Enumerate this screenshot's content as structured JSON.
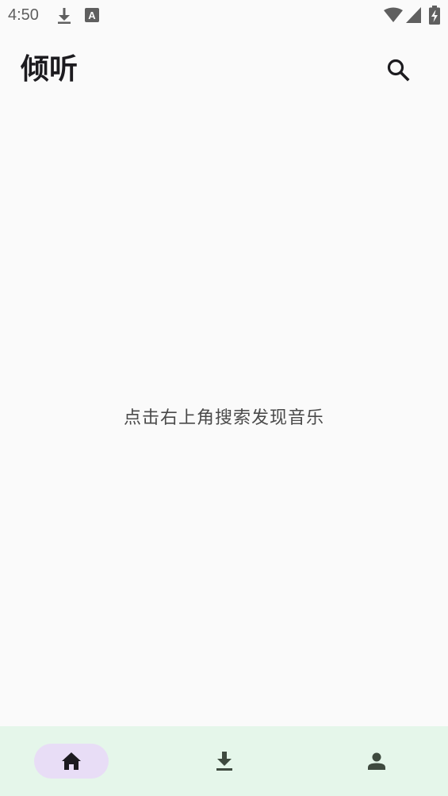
{
  "status_bar": {
    "time": "4:50",
    "icons": [
      "download-icon",
      "keyboard-a-icon",
      "wifi-icon",
      "signal-icon",
      "battery-charging-icon"
    ]
  },
  "app_bar": {
    "title": "倾听",
    "search_icon": "search-icon"
  },
  "main": {
    "empty_hint": "点击右上角搜索发现音乐"
  },
  "bottom_nav": {
    "items": [
      {
        "icon": "home-icon",
        "active": true
      },
      {
        "icon": "download-icon",
        "active": false
      },
      {
        "icon": "person-icon",
        "active": false
      }
    ]
  },
  "colors": {
    "background": "#fafafa",
    "nav_background": "#e5f6ea",
    "nav_active_pill": "#e8ddf6",
    "title_text": "#1c1b1f",
    "hint_text": "#4a4a4a"
  }
}
